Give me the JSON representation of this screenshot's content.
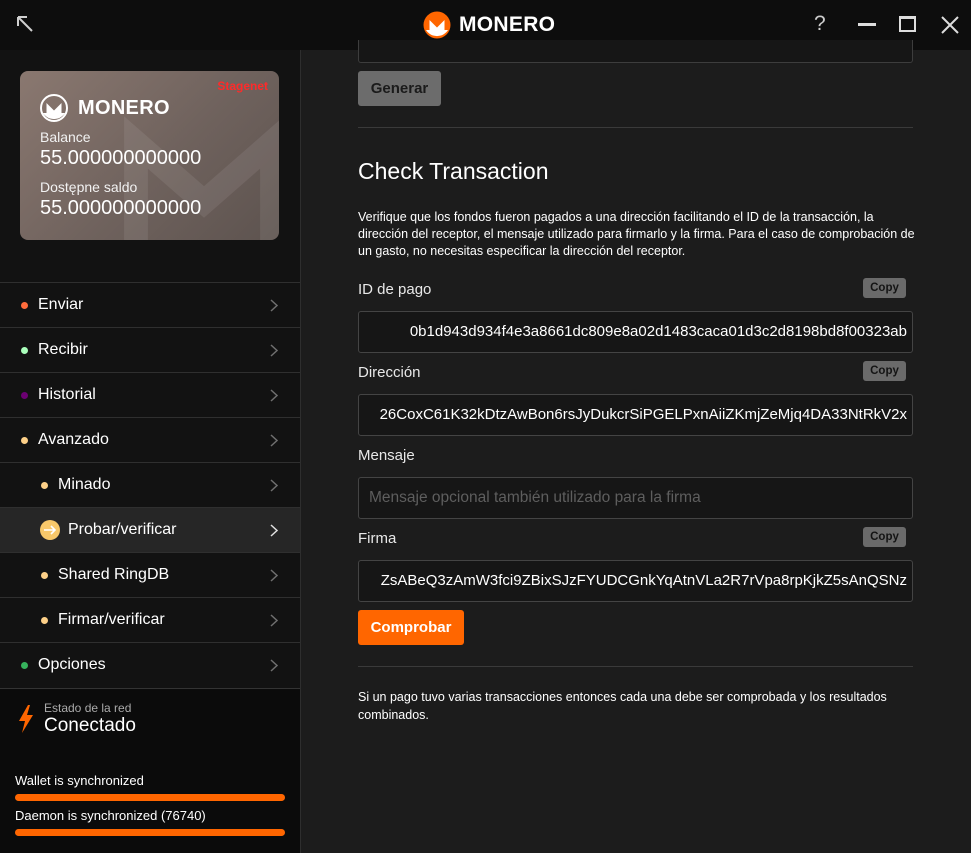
{
  "titlebar": {
    "app_name": "MONERO",
    "help_label": "?"
  },
  "sidebar": {
    "card": {
      "network": "Stagenet",
      "brand": "MONERO",
      "balance_label": "Balance",
      "balance_value": "55.000000000000",
      "unlocked_label": "Dostępne saldo",
      "unlocked_value": "55.000000000000"
    },
    "menu": [
      {
        "label": "Enviar",
        "dot_color": "#ff6c3c"
      },
      {
        "label": "Recibir",
        "dot_color": "#aaffbb"
      },
      {
        "label": "Historial",
        "dot_color": "#6b0072"
      },
      {
        "label": "Avanzado",
        "dot_color": "#fdd088"
      },
      {
        "label": "Minado",
        "dot_color": "#fdd088"
      },
      {
        "label": "Probar/verificar",
        "dot_color": "#fdd088"
      },
      {
        "label": "Shared RingDB",
        "dot_color": "#fdd088"
      },
      {
        "label": "Firmar/verificar",
        "dot_color": "#fdd088"
      },
      {
        "label": "Opciones",
        "dot_color": "#36b25c"
      }
    ],
    "network": {
      "label": "Estado de la red",
      "status": "Conectado"
    },
    "sync": {
      "wallet_label": "Wallet is synchronized",
      "wallet_progress": 1.0,
      "daemon_label": "Daemon is synchronized (76740)",
      "daemon_progress": 1.0
    }
  },
  "main": {
    "generate_button": "Generar",
    "title": "Check Transaction",
    "description": "Verifique que los fondos fueron pagados a una dirección facilitando el ID de la transacción, la dirección del receptor, el mensaje utilizado para firmarlo y la firma. Para el caso de comprobación de un gasto, no necesitas especificar la dirección del receptor.",
    "copy_label": "Copy",
    "txid_label": "ID de pago",
    "txid_value": "0b1d943d934f4e3a8661dc809e8a02d1483caca01d3c2d8198bd8f00323ab",
    "address_label": "Dirección",
    "address_value": "26CoxC61K32kDtzAwBon6rsJyDukcrSiPGELPxnAiiZKmjZeMjq4DA33NtRkV2x",
    "message_label": "Mensaje",
    "message_placeholder": "Mensaje opcional también utilizado para la firma",
    "signature_label": "Firma",
    "signature_value": "ZsABeQ3zAmW3fci9ZBixSJzFYUDCGnkYqAtnVLa2R7rVpa8rpKjkZ5sAnQSNz",
    "check_button": "Comprobar",
    "footer_note": "Si un pago tuvo varias transacciones entonces cada una debe ser comprobada y los resultados combinados."
  }
}
